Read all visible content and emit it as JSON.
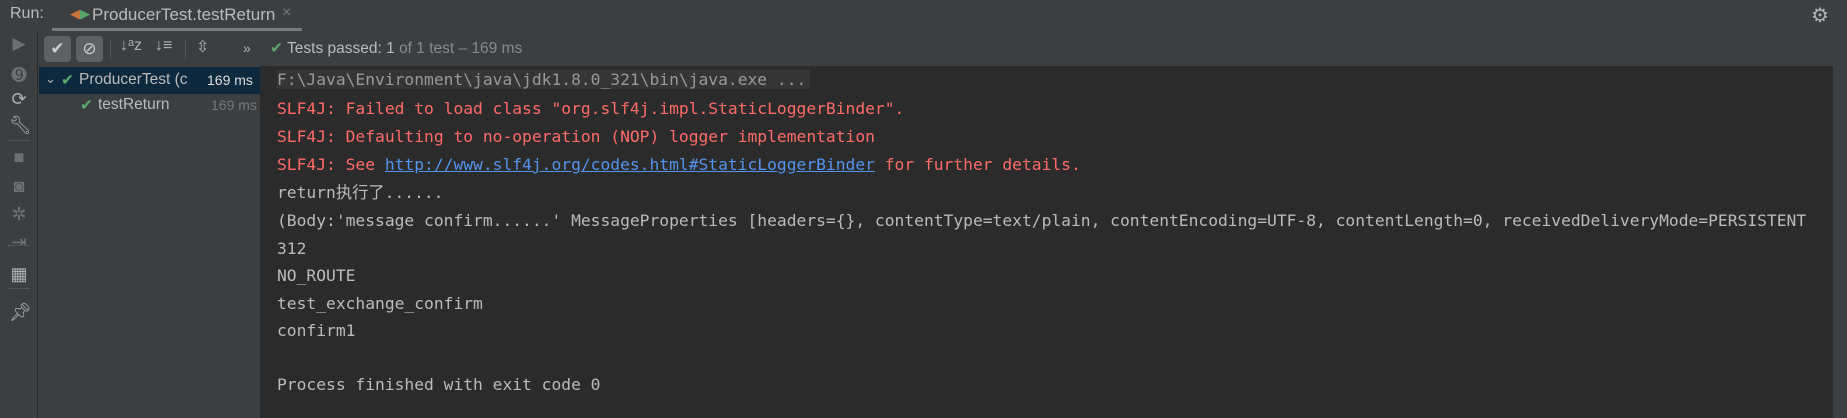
{
  "run_label": "Run:",
  "tab": {
    "title": "ProducerTest.testReturn",
    "icon": "run-test-icon",
    "close": "×"
  },
  "toolbar": {
    "buttons": [
      "show-passed-icon",
      "show-ignored-icon",
      "sort-alpha-icon",
      "sort-duration-icon",
      "expand-all-icon",
      "more-icon"
    ],
    "more": "»",
    "status_prefix": "Tests passed:",
    "status_count": "1",
    "status_rest": "of 1 test – 169 ms"
  },
  "tree": [
    {
      "label": "ProducerTest (c",
      "time": "169 ms",
      "selected": true
    },
    {
      "label": "testReturn",
      "time": "169 ms",
      "selected": false
    }
  ],
  "console": {
    "command": "F:\\Java\\Environment\\java\\jdk1.8.0_321\\bin\\java.exe ...",
    "err1": "SLF4J: Failed to load class \"org.slf4j.impl.StaticLoggerBinder\".",
    "err2": "SLF4J: Defaulting to no-operation (NOP) logger implementation",
    "err3_pre": "SLF4J: See ",
    "err3_link": "http://www.slf4j.org/codes.html#StaticLoggerBinder",
    "err3_post": " for further details.",
    "out": [
      "return执行了......",
      "(Body:'message confirm......' MessageProperties [headers={}, contentType=text/plain, contentEncoding=UTF-8, contentLength=0, receivedDeliveryMode=PERSISTENT",
      "312",
      "NO_ROUTE",
      "test_exchange_confirm",
      "confirm1"
    ],
    "exit": "Process finished with exit code 0"
  },
  "colors": {
    "error": "#ff6b68",
    "link": "#5394ec",
    "success": "#59a869",
    "selection": "#0d293e"
  }
}
